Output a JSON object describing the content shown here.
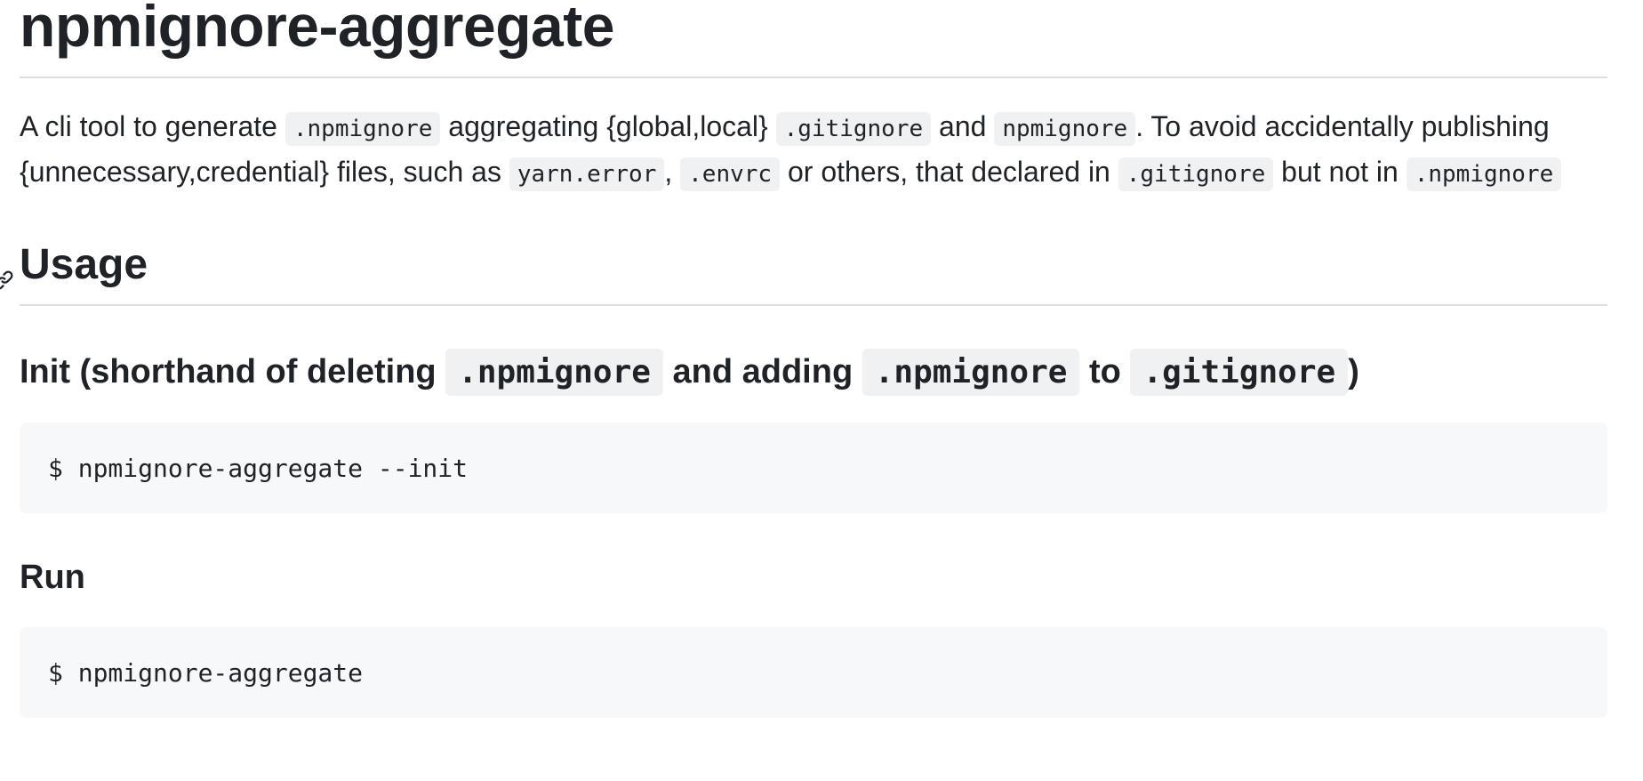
{
  "title": "npmignore-aggregate",
  "intro": {
    "t1": "A cli tool to generate ",
    "c1": ".npmignore",
    "t2": " aggregating {global,local} ",
    "c2": ".gitignore",
    "t3": " and ",
    "c3": "npmignore",
    "t4": ". To avoid accidentally publishing {unnecessary,credential} files, such as ",
    "c4": "yarn.error",
    "t5": ", ",
    "c5": ".envrc",
    "t6": " or others, that declared in ",
    "c6": ".gitignore",
    "t7": " but not in ",
    "c7": ".npmignore"
  },
  "usage": {
    "heading": "Usage",
    "init": {
      "h_t1": "Init (shorthand of deleting ",
      "h_c1": ".npmignore",
      "h_t2": " and adding ",
      "h_c2": ".npmignore",
      "h_t3": " to ",
      "h_c3": ".gitignore",
      "h_t4": ")",
      "code": "$ npmignore-aggregate --init"
    },
    "run": {
      "heading": "Run",
      "code": "$ npmignore-aggregate"
    }
  },
  "colors": {
    "text": "#1f2328",
    "code_bg": "#f6f8fa",
    "inline_code_bg": "#eff1f3",
    "divider": "#d8dee4"
  }
}
